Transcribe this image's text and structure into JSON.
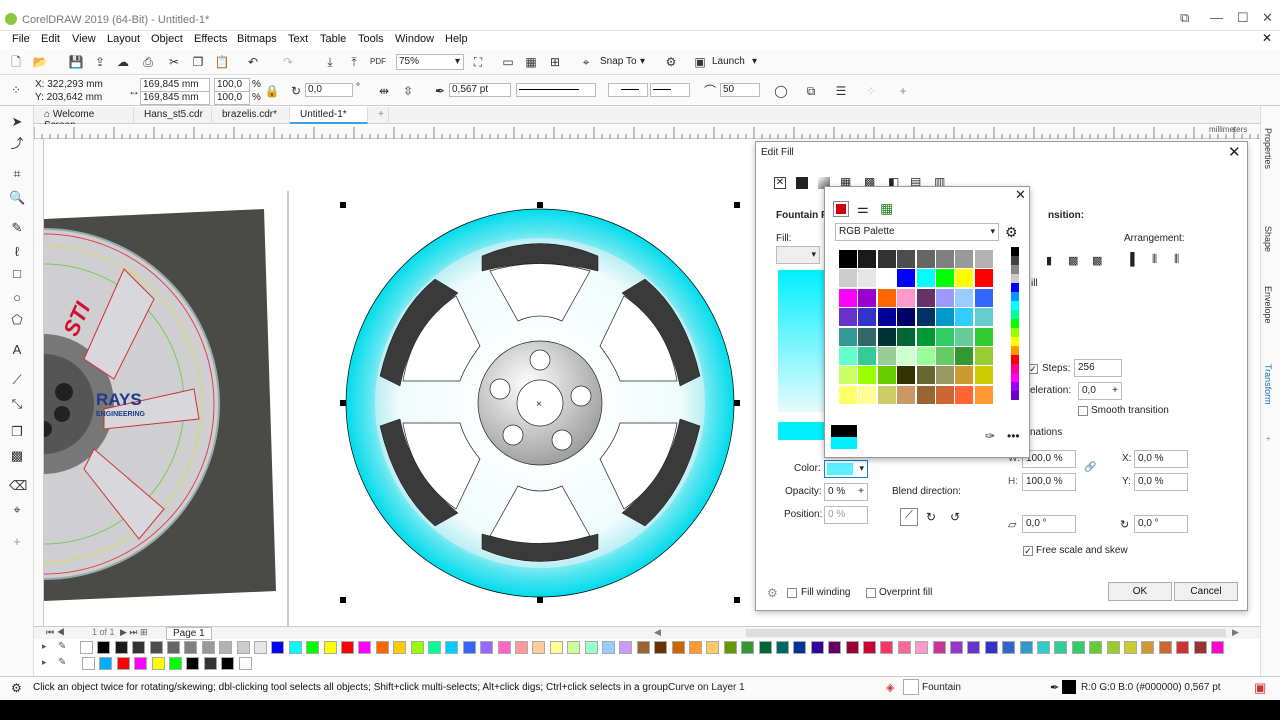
{
  "window": {
    "title": "CorelDRAW 2019 (64-Bit) - Untitled-1*"
  },
  "menu": [
    "File",
    "Edit",
    "View",
    "Layout",
    "Object",
    "Effects",
    "Bitmaps",
    "Text",
    "Table",
    "Tools",
    "Window",
    "Help"
  ],
  "toolbar": {
    "zoom": "75%",
    "snap": "Snap To",
    "launch": "Launch"
  },
  "propbar": {
    "x": "X: 322,293 mm",
    "y": "Y: 203,642 mm",
    "w": "169,845 mm",
    "h": "169,845 mm",
    "sx": "100,0",
    "sy": "100,0",
    "angle": "0,0",
    "outline": "0,567 pt",
    "smooth": "50"
  },
  "tabs": [
    "Welcome Screen",
    "Hans_st5.cdr",
    "brazelis.cdr*",
    "Untitled-1*"
  ],
  "ruler_unit": "millimeters",
  "dockers": [
    "Properties",
    "Shape",
    "Envelope",
    "Transform"
  ],
  "page_tab": "Page 1",
  "page_counter": "1 of 1",
  "wheel_text": [
    "STI",
    "RAYS",
    "ENGINEERING"
  ],
  "edit_fill": {
    "title": "Edit Fill",
    "fountain_fill": "Fountain Fi",
    "fill_label": "Fill:",
    "transition": "nsition:",
    "arrangement": "Arrangement:",
    "fill_short": "ill",
    "steps_label": "Steps:",
    "steps": "256",
    "acceleration_label": "eleration:",
    "acceleration": "0,0",
    "smooth_transition": "Smooth transition",
    "transformations": "nations",
    "w_label": "W:",
    "w": "100,0 %",
    "h_label": "H:",
    "h": "100,0 %",
    "x_label": "X:",
    "x": "0,0 %",
    "y_label": "Y:",
    "y": "0,0 %",
    "skew": "0,0 °",
    "rotate": "0,0 °",
    "free_scale": "Free scale and skew",
    "color_label": "Color:",
    "opacity_label": "Opacity:",
    "opacity": "0 %",
    "position_label": "Position:",
    "position": "0 %",
    "blend_direction": "Blend direction:",
    "fill_winding": "Fill winding",
    "overprint_fill": "Overprint fill",
    "ok": "OK",
    "cancel": "Cancel"
  },
  "palette_popup": {
    "palette_name": "RGB Palette"
  },
  "colors": {
    "cyan": "#00e5f5",
    "accent": "#00aaff",
    "dark_spoke": "#3a3a3a"
  },
  "status": {
    "hint": "Click an object twice for rotating/skewing; dbl-clicking tool selects all objects; Shift+click multi-selects; Alt+click digs; Ctrl+click selects in a group",
    "object": "Curve on Layer 1",
    "fill": "Fountain",
    "outline": "R:0 G:0 B:0 (#000000)  0,567 pt"
  }
}
